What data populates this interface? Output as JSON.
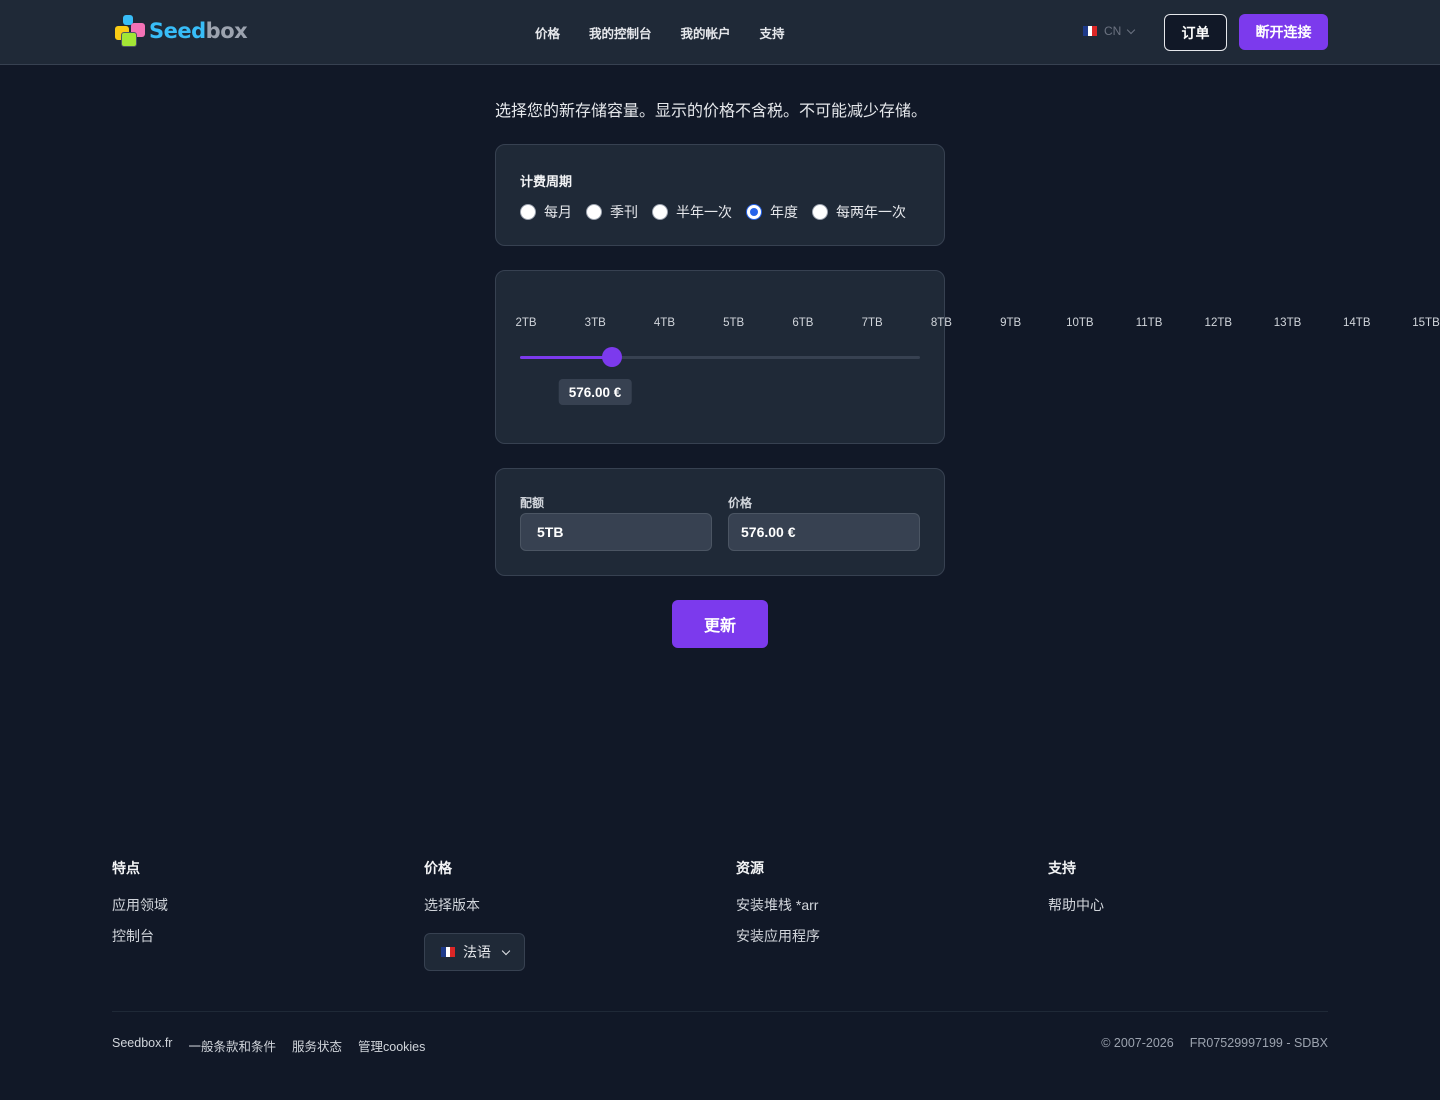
{
  "header": {
    "logo_text_part1": "Seed",
    "logo_text_part2": "box",
    "nav": [
      "价格",
      "我的控制台",
      "我的帐户",
      "支持"
    ],
    "language": "CN",
    "order_button": "订单",
    "logout_button": "断开连接"
  },
  "main": {
    "intro": "选择您的新存储容量。显示的价格不含税。不可能减少存储。",
    "billing": {
      "label": "计费周期",
      "options": [
        "每月",
        "季刊",
        "半年一次",
        "年度",
        "每两年一次"
      ],
      "selected": "年度"
    },
    "slider": {
      "ticks": [
        "2TB",
        "3TB",
        "4TB",
        "5TB",
        "6TB",
        "7TB",
        "8TB",
        "9TB",
        "10TB",
        "11TB",
        "12TB",
        "13TB",
        "14TB",
        "15TB"
      ],
      "selected_index": 3,
      "price_bubble": "576.00 €"
    },
    "summary": {
      "quota_label": "配额",
      "quota_value": "5TB",
      "price_label": "价格",
      "price_value": "576.00 €"
    },
    "update_button": "更新"
  },
  "footer": {
    "columns": [
      {
        "title": "特点",
        "links": [
          "应用领域",
          "控制台"
        ]
      },
      {
        "title": "价格",
        "links": [
          "选择版本"
        ]
      },
      {
        "title": "资源",
        "links": [
          "安装堆栈 *arr",
          "安装应用程序"
        ]
      },
      {
        "title": "支持",
        "links": [
          "帮助中心"
        ]
      }
    ],
    "language_select": "法语",
    "bottom_links": [
      "Seedbox.fr",
      "一般条款和条件",
      "服务状态",
      "管理cookies"
    ],
    "copyright": "© 2007-2026",
    "company_id": "FR07529997199 - SDBX"
  },
  "colors": {
    "accent": "#7c3aed",
    "background": "#111827",
    "card": "#1f2937"
  }
}
